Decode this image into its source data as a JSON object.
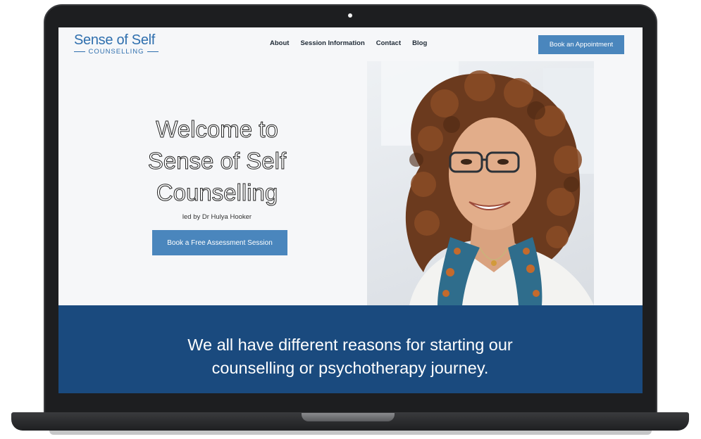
{
  "logo": {
    "name": "Sense of Self",
    "tagline": "COUNSELLING"
  },
  "nav": {
    "items": [
      {
        "label": "About"
      },
      {
        "label": "Session Information"
      },
      {
        "label": "Contact"
      },
      {
        "label": "Blog"
      }
    ]
  },
  "header": {
    "cta_label": "Book an Appointment"
  },
  "hero": {
    "title_line1": "Welcome to",
    "title_line2": "Sense of Self",
    "title_line3": "Counselling",
    "subtitle": "led by Dr Hulya Hooker",
    "cta_label": "Book a Free Assessment Session"
  },
  "band": {
    "line1": "We all have different reasons for starting our",
    "line2": "counselling or psychotherapy journey."
  },
  "colors": {
    "brand_blue": "#2f6fae",
    "button_blue": "#4a86bd",
    "band_blue": "#1a4a7e"
  }
}
